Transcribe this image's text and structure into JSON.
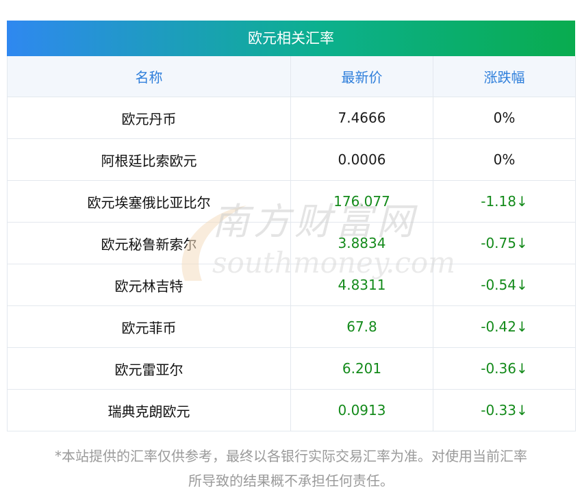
{
  "title": "欧元相关汇率",
  "headers": [
    "名称",
    "最新价",
    "涨跌幅"
  ],
  "rows": [
    {
      "name": "欧元丹币",
      "price": "7.4666",
      "change": "0%"
    },
    {
      "name": "阿根廷比索欧元",
      "price": "0.0006",
      "change": "0%"
    },
    {
      "name": "欧元埃塞俄比亚比尔",
      "price": "176.077",
      "change": "-1.18↓"
    },
    {
      "name": "欧元秘鲁新索尔",
      "price": "3.8834",
      "change": "-0.75↓"
    },
    {
      "name": "欧元林吉特",
      "price": "4.8311",
      "change": "-0.54↓"
    },
    {
      "name": "欧元菲币",
      "price": "67.8",
      "change": "-0.42↓"
    },
    {
      "name": "欧元雷亚尔",
      "price": "6.201",
      "change": "-0.36↓"
    },
    {
      "name": "瑞典克朗欧元",
      "price": "0.0913",
      "change": "-0.33↓"
    }
  ],
  "watermark": {
    "cn": "南方财富网",
    "en": "southmoney.com"
  },
  "note_line1": "*本站提供的汇率仅供参考，最终以各银行实际交易汇率为准。对使用当前汇率",
  "note_line2": "所导致的结果概不承担任何责任。",
  "colors": {
    "header_text": "#2f7fdb",
    "down": "#138a1a",
    "title_start": "#2f88f0",
    "title_end": "#09ac4f"
  }
}
